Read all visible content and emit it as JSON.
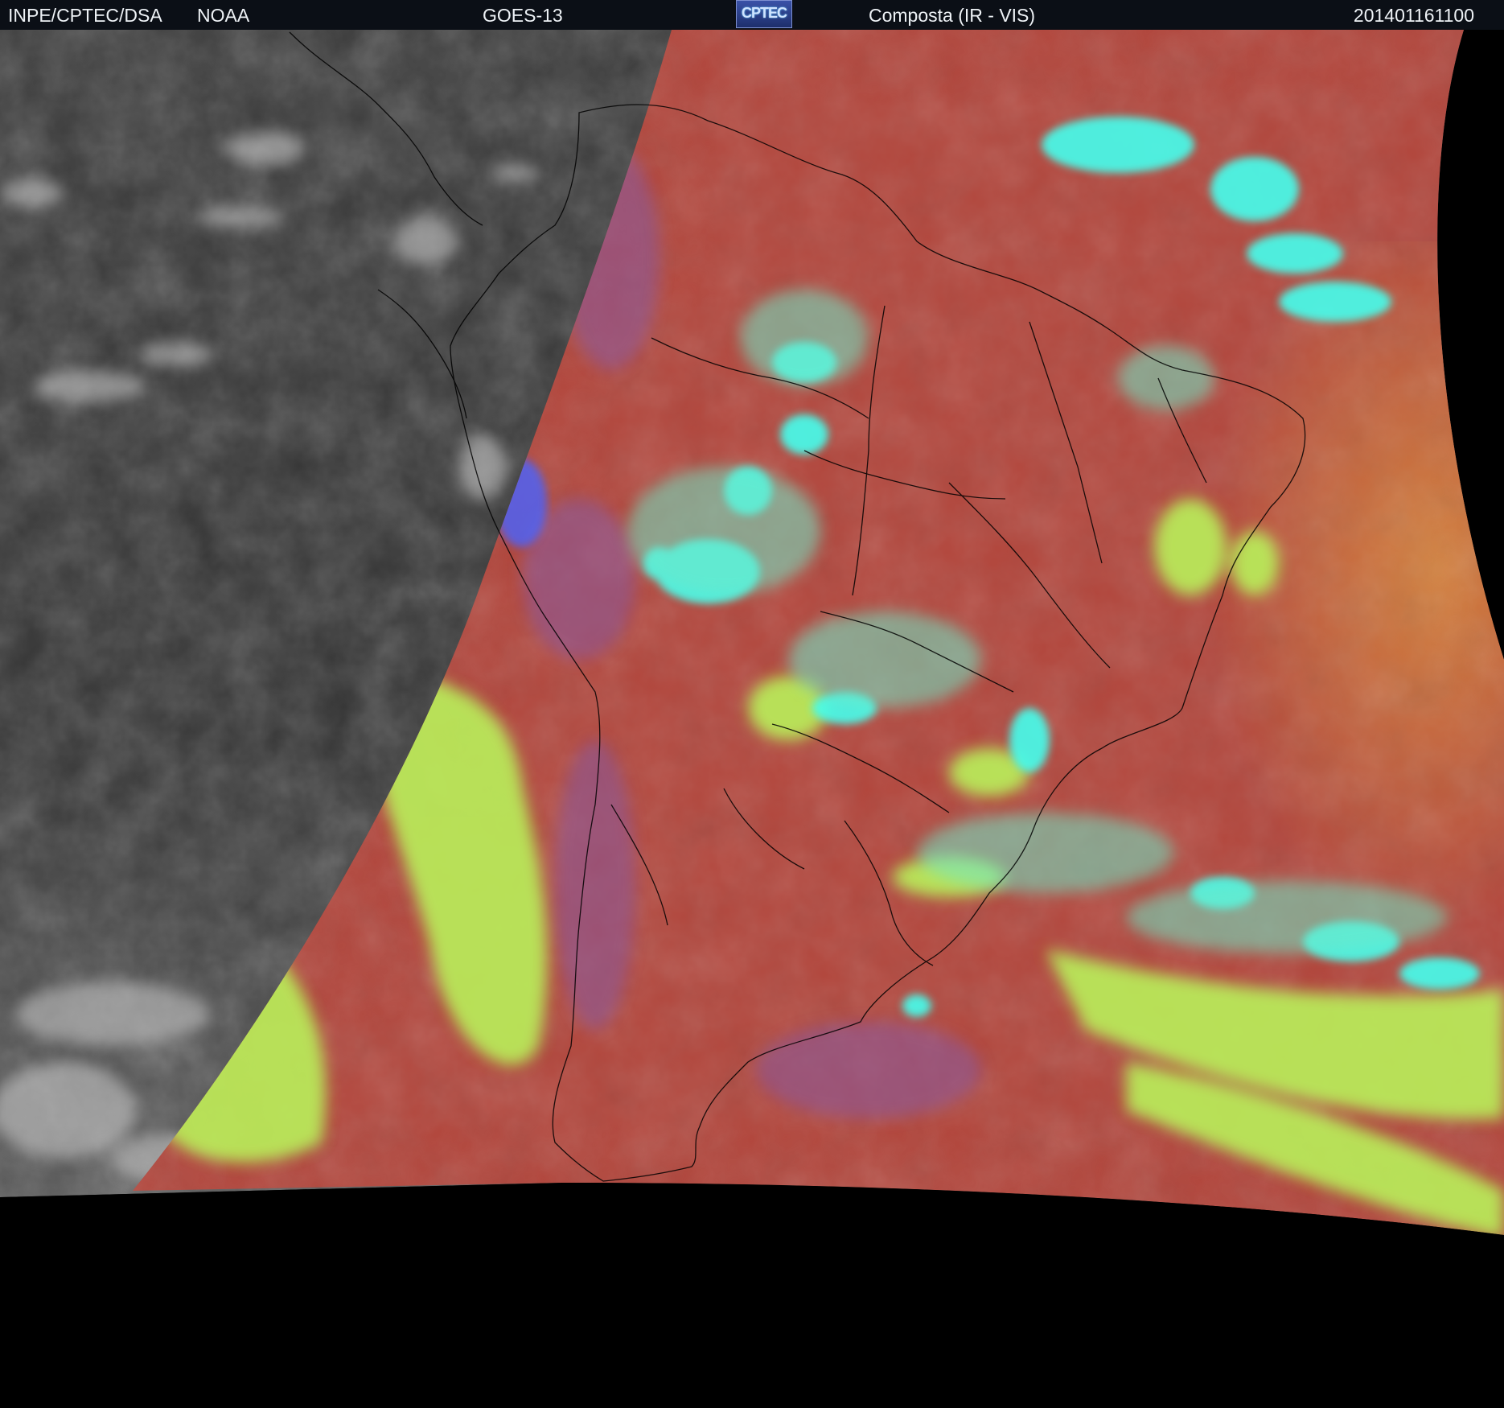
{
  "header": {
    "agency": "INPE/CPTEC/DSA",
    "source": "NOAA",
    "satellite": "GOES-13",
    "logo_text": "CPTEC",
    "product": "Composta (IR - VIS)",
    "timestamp": "201401161100"
  },
  "colors": {
    "header_bg": "#0b0f16",
    "space": "#000000",
    "ir_gray": "#3a3a3a",
    "warm_red": "#b2463c",
    "cloud_cyan": "#44ffee",
    "low_cloud_yellowgreen": "#b9f05a",
    "orange": "#d1713f",
    "coastline": "#000000"
  }
}
